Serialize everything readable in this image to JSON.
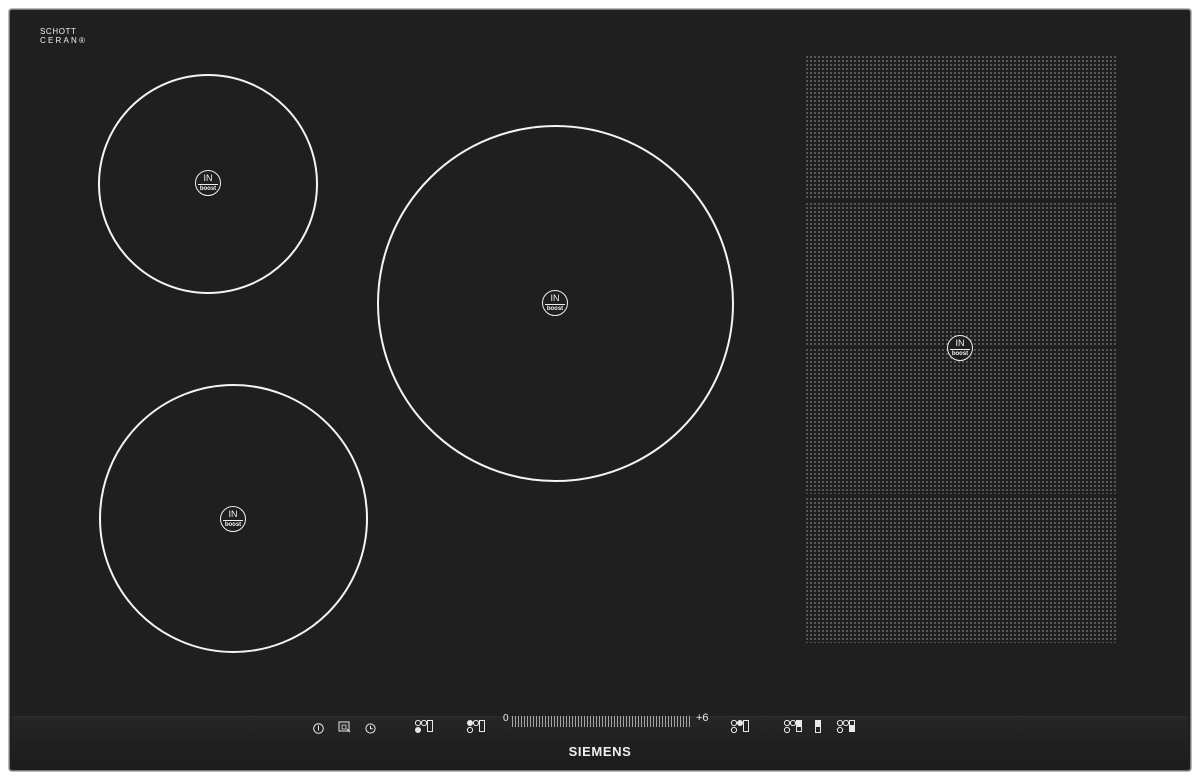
{
  "brand": {
    "glass_line1": "SCHOTT",
    "glass_line2": "CERAN®",
    "glass_fine": "",
    "maker": "SIEMENS"
  },
  "zones": {
    "badge_top": "IN",
    "badge_bottom": "boost"
  },
  "controls": {
    "slider_min": "0",
    "slider_max": "+6",
    "icons": [
      "power-icon",
      "lock-icon",
      "timer-icon",
      "zone-select-icon",
      "zone-select-icon",
      "zone-select-icon",
      "zone-select-icon",
      "flex-divider-icon",
      "zone-select-icon"
    ]
  },
  "colors": {
    "glass": "#1f1f1f",
    "markings": "#f4f4f4"
  }
}
